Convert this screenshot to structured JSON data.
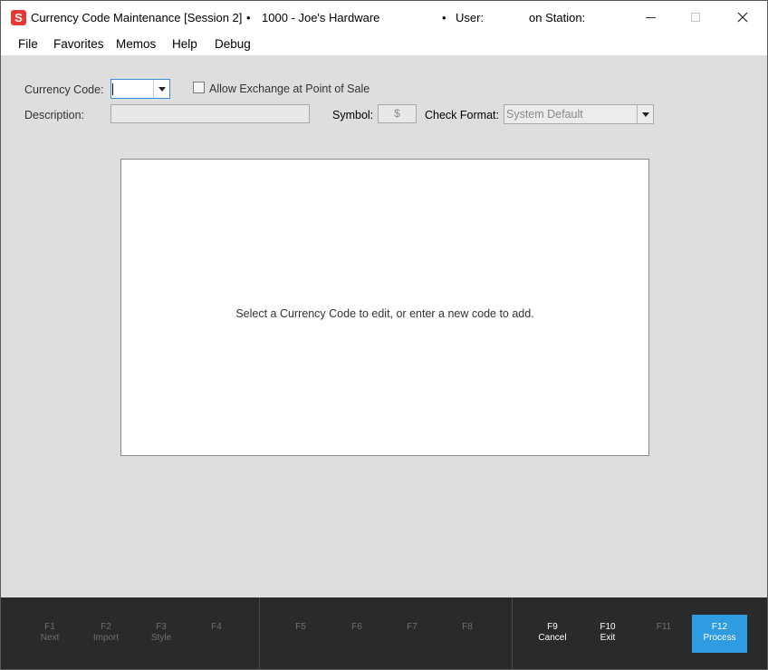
{
  "window": {
    "app_icon_letter": "S",
    "title": "Currency Code Maintenance [Session 2]",
    "bullet1": "•",
    "company": "1000 - Joe's Hardware",
    "bullet2": "•",
    "user_label": "User:",
    "station_label": "on Station:",
    "close_glyph": "✕"
  },
  "menu": {
    "items": [
      "File",
      "Favorites",
      "Memos",
      "Help",
      "Debug"
    ]
  },
  "form": {
    "currency_code_label": "Currency Code:",
    "currency_code_value": "",
    "allow_exchange_label": "Allow Exchange at Point of Sale",
    "allow_exchange_checked": false,
    "description_label": "Description:",
    "description_value": "",
    "symbol_label": "Symbol:",
    "symbol_value": "$",
    "check_format_label": "Check Format:",
    "check_format_value": "System Default"
  },
  "panel": {
    "message": "Select a Currency Code to edit, or enter a new code to add."
  },
  "footer": {
    "keys": [
      {
        "key": "F1",
        "label": "Next",
        "enabled": false
      },
      {
        "key": "F2",
        "label": "Import",
        "enabled": false
      },
      {
        "key": "F3",
        "label": "Style",
        "enabled": false
      },
      {
        "key": "F4",
        "label": "",
        "enabled": false
      },
      {
        "key": "F5",
        "label": "",
        "enabled": false
      },
      {
        "key": "F6",
        "label": "",
        "enabled": false
      },
      {
        "key": "F7",
        "label": "",
        "enabled": false
      },
      {
        "key": "F8",
        "label": "",
        "enabled": false
      },
      {
        "key": "F9",
        "label": "Cancel",
        "enabled": true
      },
      {
        "key": "F10",
        "label": "Exit",
        "enabled": true
      },
      {
        "key": "F11",
        "label": "",
        "enabled": false
      },
      {
        "key": "F12",
        "label": "Process",
        "enabled": true
      }
    ],
    "process_color": "#2f9be0"
  }
}
